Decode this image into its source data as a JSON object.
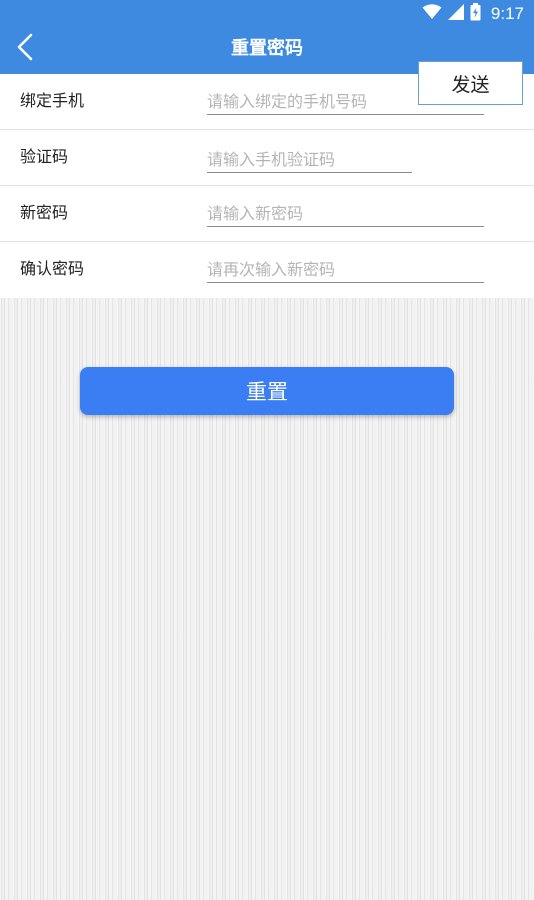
{
  "status_bar": {
    "time": "9:17",
    "icons": [
      "wifi-icon",
      "signal-icon",
      "battery-icon"
    ]
  },
  "header": {
    "title": "重置密码",
    "back_icon": "chevron-left-icon",
    "background_color": "#3d8ae0"
  },
  "form": {
    "phone": {
      "label": "绑定手机",
      "placeholder": "请输入绑定的手机号码",
      "value": ""
    },
    "code": {
      "label": "验证码",
      "placeholder": "请输入手机验证码",
      "value": "",
      "send_label": "发送"
    },
    "new_password": {
      "label": "新密码",
      "placeholder": "请输入新密码",
      "value": ""
    },
    "confirm_password": {
      "label": "确认密码",
      "placeholder": "请再次输入新密码",
      "value": ""
    }
  },
  "actions": {
    "reset_label": "重置",
    "button_color": "#3b7ef4"
  }
}
